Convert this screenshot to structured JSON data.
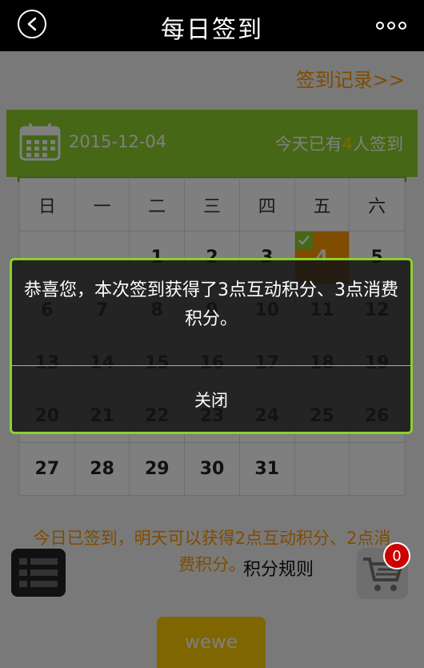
{
  "header": {
    "title": "每日签到",
    "back_icon": "chevron-left-icon",
    "more_icon": "more-dots-icon"
  },
  "record_link": "签到记录>>",
  "sign_bar": {
    "date": "2015-12-04",
    "count_prefix": "今天已有",
    "count_value": "4",
    "count_suffix": "人签到",
    "accent_color": "#8ccf2c"
  },
  "calendar": {
    "weekdays": [
      "日",
      "一",
      "二",
      "三",
      "四",
      "五",
      "六"
    ],
    "weeks": [
      [
        "",
        "",
        "1",
        "2",
        "3",
        "4",
        "5"
      ],
      [
        "6",
        "7",
        "8",
        "9",
        "10",
        "11",
        "12"
      ],
      [
        "13",
        "14",
        "15",
        "16",
        "17",
        "18",
        "19"
      ],
      [
        "20",
        "21",
        "22",
        "23",
        "24",
        "25",
        "26"
      ],
      [
        "27",
        "28",
        "29",
        "30",
        "31",
        "",
        ""
      ]
    ],
    "today": "4",
    "today_color": "#ff9900"
  },
  "tip": {
    "text": "今日已签到，明天可以获得2点互动积分、2点消费积分。"
  },
  "rules_link": "积分规则",
  "cart_badge": "0",
  "bottom_button": "wewe",
  "dialog": {
    "message": "恭喜您，本次签到获得了3点互动积分、3点消费积分。",
    "close_label": "关闭"
  }
}
